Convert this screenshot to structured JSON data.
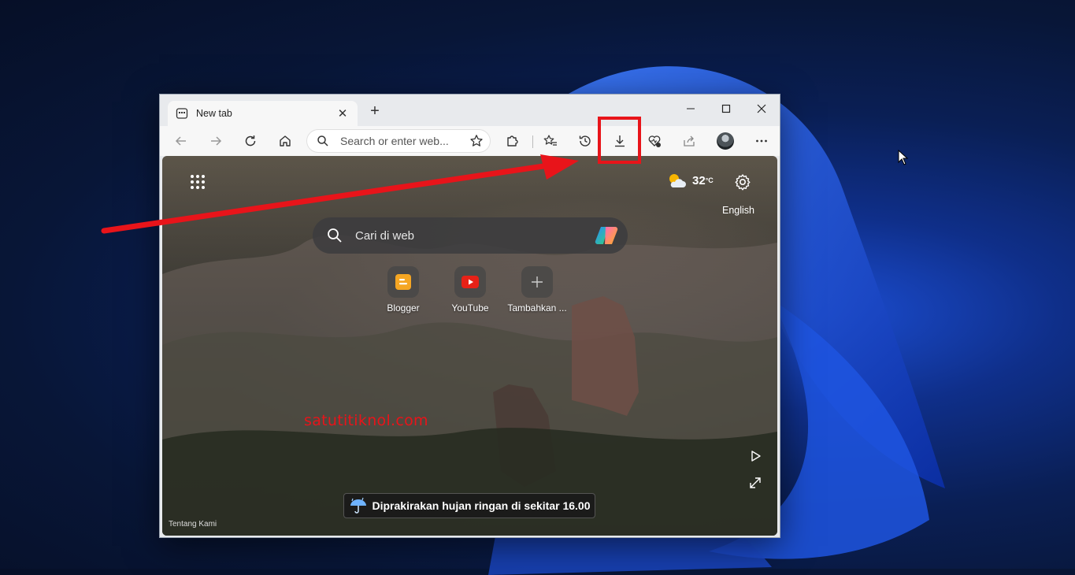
{
  "browser": {
    "tab_title": "New tab",
    "address_placeholder": "Search or enter web..."
  },
  "newtab": {
    "weather_temp": "32",
    "weather_unit": "°C",
    "language": "English",
    "search_placeholder": "Cari di web",
    "tiles": [
      {
        "label": "Blogger"
      },
      {
        "label": "YouTube"
      },
      {
        "label": "Tambahkan ..."
      }
    ],
    "weather_banner": "Diprakirakan hujan ringan di sekitar 16.00",
    "about": "Tentang Kami"
  },
  "watermark": "satutitiknol.com",
  "colors": {
    "highlight": "#e8141a",
    "blogger": "#f5a623",
    "youtube": "#e62117"
  }
}
